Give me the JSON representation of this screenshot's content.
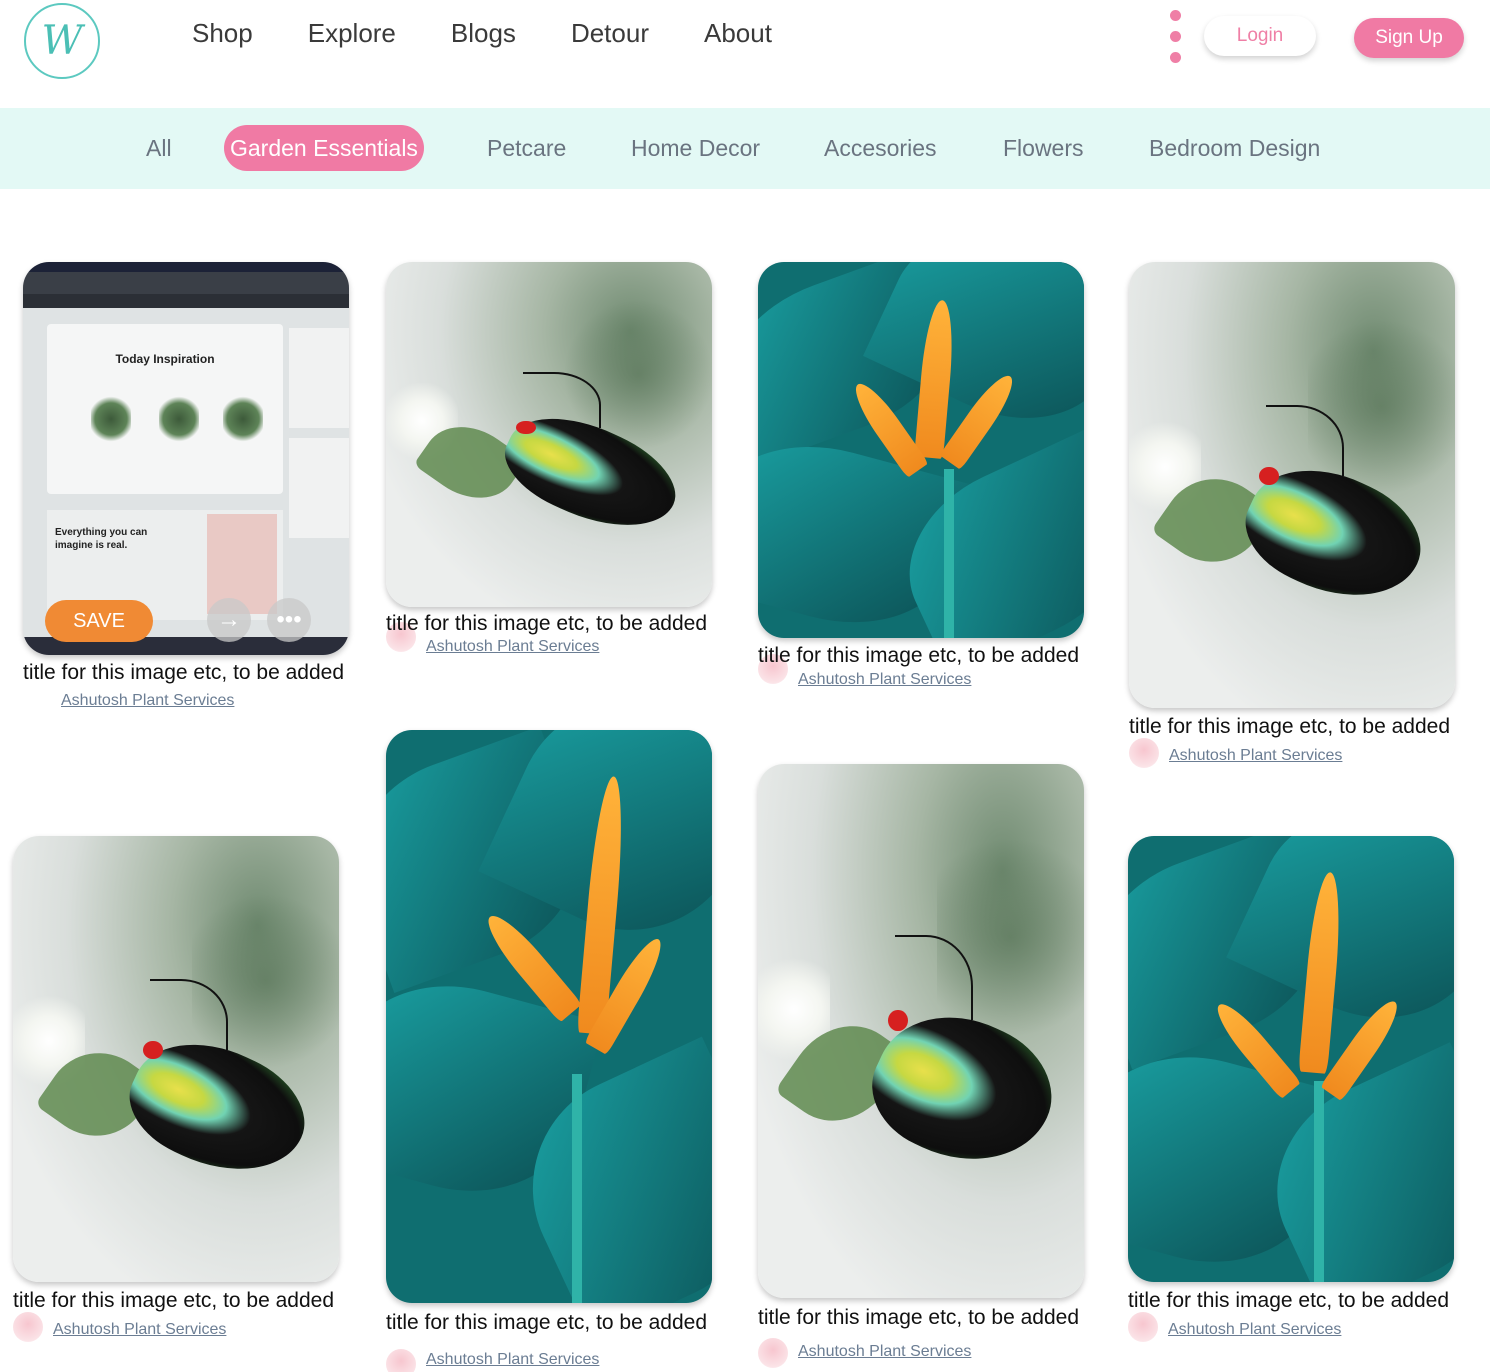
{
  "brand": {
    "logo_letter": "W"
  },
  "nav": [
    "Shop",
    "Explore",
    "Blogs",
    "Detour",
    "About"
  ],
  "auth": {
    "login": "Login",
    "signup": "Sign Up"
  },
  "categories": [
    "All",
    "Garden Essentials",
    "Petcare",
    "Home Decor",
    "Accesories",
    "Flowers",
    "Bedroom Design"
  ],
  "active_category": "Garden Essentials",
  "colors": {
    "accent_pink": "#f07aa4",
    "logo_teal": "#4bbfb5",
    "category_bar_bg": "#e3f9f5",
    "save_orange": "#f08a34"
  },
  "first_pin_overlay": {
    "save": "SAVE",
    "screenshot_texts": [
      "Today Inspiration",
      "Everything you can imagine is real."
    ],
    "icons": [
      "arrow-right-icon",
      "more-dots-icon"
    ]
  },
  "pins": [
    {
      "image": "screenshot",
      "title": "title for this image etc, to be added",
      "author": "Ashutosh Plant Services"
    },
    {
      "image": "butterfly",
      "title": "title for this image etc, to be added",
      "author": "Ashutosh Plant Services"
    },
    {
      "image": "heliconia",
      "title": "title for this image etc, to be added",
      "author": "Ashutosh Plant Services"
    },
    {
      "image": "butterfly",
      "title": "title for this image etc, to be added",
      "author": "Ashutosh Plant Services"
    },
    {
      "image": "butterfly",
      "title": "title for this image etc, to be added",
      "author": "Ashutosh Plant Services"
    },
    {
      "image": "heliconia",
      "title": "title for this image etc, to be added",
      "author": "Ashutosh Plant Services"
    },
    {
      "image": "butterfly",
      "title": "title for this image etc, to be added",
      "author": "Ashutosh Plant Services"
    },
    {
      "image": "heliconia",
      "title": "title for this image etc, to be added",
      "author": "Ashutosh Plant Services"
    }
  ]
}
